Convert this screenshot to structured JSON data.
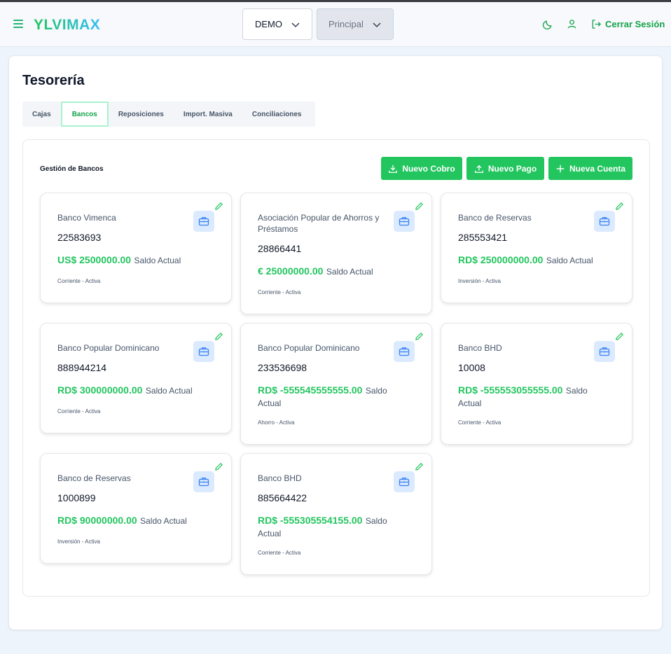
{
  "header": {
    "logo": "YLVIMAX",
    "company_select": "DEMO",
    "branch_select": "Principal",
    "logout_label": "Cerrar Sesión"
  },
  "page": {
    "title": "Tesorería",
    "tabs": [
      {
        "label": "Cajas",
        "active": false
      },
      {
        "label": "Bancos",
        "active": true
      },
      {
        "label": "Reposiciones",
        "active": false
      },
      {
        "label": "Import. Masiva",
        "active": false
      },
      {
        "label": "Conciliaciones",
        "active": false
      }
    ]
  },
  "section": {
    "title": "Gestión de Bancos",
    "buttons": {
      "nuevo_cobro": "Nuevo Cobro",
      "nuevo_pago": "Nuevo Pago",
      "nueva_cuenta": "Nueva Cuenta"
    }
  },
  "colors": {
    "accent": "#22c55e",
    "icon_bg": "#dbeafe",
    "icon_fg": "#3b82f6"
  },
  "cards": [
    {
      "bank": "Banco Vimenca",
      "account": "22583693",
      "amount": "US$ 2500000.00",
      "saldo": "Saldo Actual",
      "status": "Corriente - Activa"
    },
    {
      "bank": "Asociación Popular de Ahorros y Préstamos",
      "account": "28866441",
      "amount": "€ 25000000.00",
      "saldo": "Saldo Actual",
      "status": "Corriente - Activa"
    },
    {
      "bank": "Banco de Reservas",
      "account": "285553421",
      "amount": "RD$ 250000000.00",
      "saldo": "Saldo Actual",
      "status": "Inversión - Activa"
    },
    {
      "bank": "Banco Popular Dominicano",
      "account": "888944214",
      "amount": "RD$ 300000000.00",
      "saldo": "Saldo Actual",
      "status": "Corriente - Activa"
    },
    {
      "bank": "Banco Popular Dominicano",
      "account": "233536698",
      "amount": "RD$ -555545555555.00",
      "saldo": "Saldo Actual",
      "status": "Ahorro - Activa"
    },
    {
      "bank": "Banco BHD",
      "account": "10008",
      "amount": "RD$ -555553055555.00",
      "saldo": "Saldo Actual",
      "status": "Corriente - Activa"
    },
    {
      "bank": "Banco de Reservas",
      "account": "1000899",
      "amount": "RD$ 90000000.00",
      "saldo": "Saldo Actual",
      "status": "Inversión - Activa"
    },
    {
      "bank": "Banco BHD",
      "account": "885664422",
      "amount": "RD$ -555305554155.00",
      "saldo": "Saldo Actual",
      "status": "Corriente - Activa"
    }
  ]
}
